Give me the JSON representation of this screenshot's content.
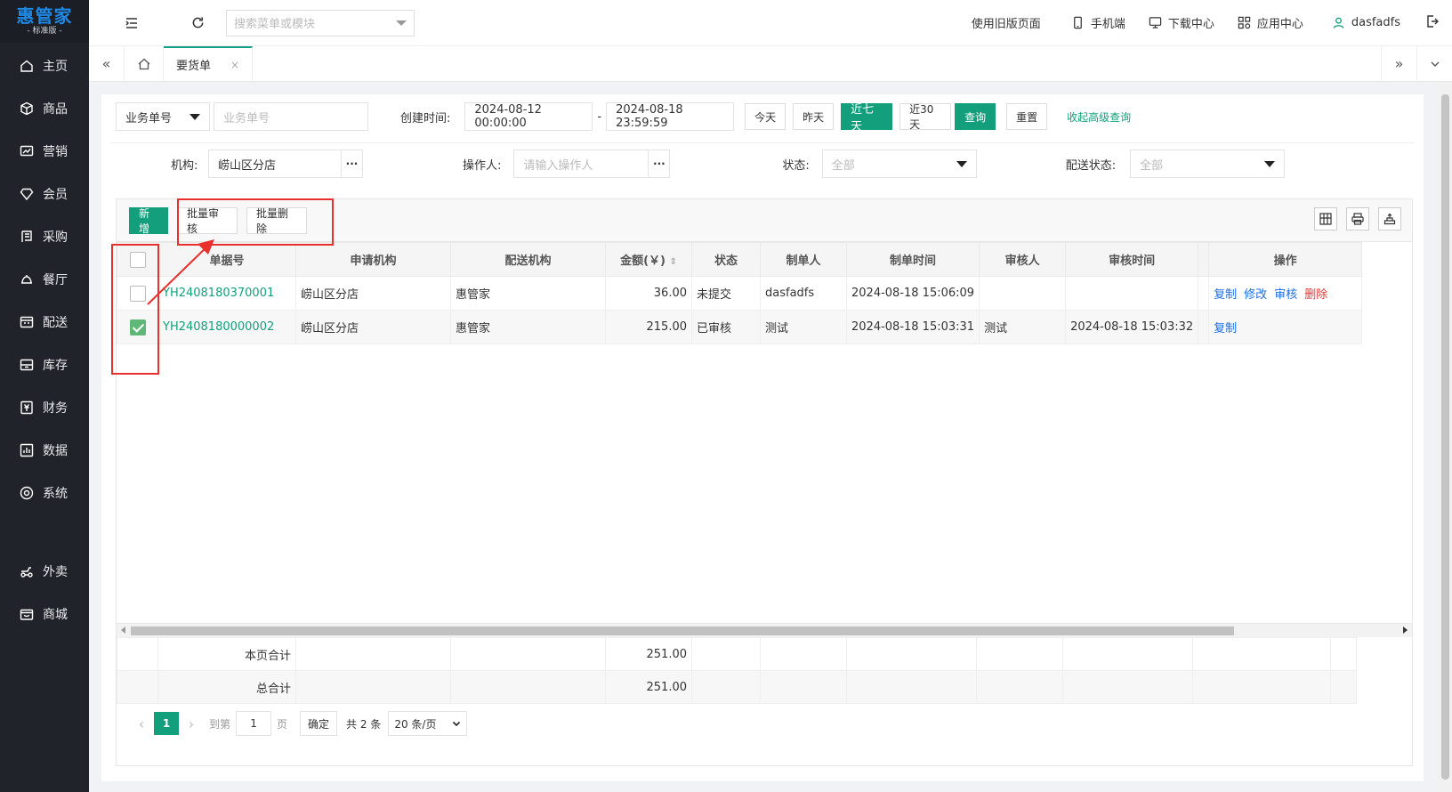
{
  "sidebar": {
    "brand": "惠管家",
    "edition": "- 标准版 -",
    "items": [
      {
        "label": "主页",
        "icon": "home-icon"
      },
      {
        "label": "商品",
        "icon": "box-icon"
      },
      {
        "label": "营销",
        "icon": "chart-icon"
      },
      {
        "label": "会员",
        "icon": "diamond-icon"
      },
      {
        "label": "采购",
        "icon": "purchase-icon"
      },
      {
        "label": "餐厅",
        "icon": "dining-icon"
      },
      {
        "label": "配送",
        "icon": "delivery-icon"
      },
      {
        "label": "库存",
        "icon": "inventory-icon"
      },
      {
        "label": "财务",
        "icon": "finance-icon"
      },
      {
        "label": "数据",
        "icon": "data-icon"
      },
      {
        "label": "系统",
        "icon": "settings-icon"
      }
    ],
    "extra_items": [
      {
        "label": "外卖",
        "icon": "takeout-icon"
      },
      {
        "label": "商城",
        "icon": "mall-icon"
      }
    ]
  },
  "topbar": {
    "search_placeholder": "搜索菜单或模块",
    "old_page": "使用旧版页面",
    "mobile": "手机端",
    "download": "下载中心",
    "apps": "应用中心",
    "user": "dasfadfs"
  },
  "tabs": {
    "active": "要货单",
    "close": "×"
  },
  "filters": {
    "field_select": "业务单号",
    "field_placeholder": "业务单号",
    "created_label": "创建时间:",
    "date_start": "2024-08-12 00:00:00",
    "date_sep": "-",
    "date_end": "2024-08-18 23:59:59",
    "btn_today": "今天",
    "btn_yesterday": "昨天",
    "btn_7days": "近七天",
    "btn_30days": "近30天",
    "btn_query": "查询",
    "btn_reset": "重置",
    "advanced": "收起高级查询",
    "org_label": "机构:",
    "org_value": "崂山区分店",
    "operator_label": "操作人:",
    "operator_placeholder": "请输入操作人",
    "status_label": "状态:",
    "status_value": "全部",
    "delivery_status_label": "配送状态:",
    "delivery_status_value": "全部",
    "dots": "···"
  },
  "toolbar": {
    "add": "新增",
    "batch_approve": "批量审核",
    "batch_delete": "批量删除"
  },
  "table": {
    "headers": [
      "单据号",
      "申请机构",
      "配送机构",
      "金额(￥)",
      "状态",
      "制单人",
      "制单时间",
      "审核人",
      "审核时间",
      "操作"
    ],
    "rows": [
      {
        "checked": false,
        "doc": "YH2408180370001",
        "apply_org": "崂山区分店",
        "delivery_org": "惠管家",
        "amount": "36.00",
        "status": "未提交",
        "creator": "dasfadfs",
        "created": "2024-08-18 15:06:09",
        "approver": "",
        "approved": "",
        "ops": [
          "复制",
          "修改",
          "审核",
          "删除"
        ]
      },
      {
        "checked": true,
        "doc": "YH2408180000002",
        "apply_org": "崂山区分店",
        "delivery_org": "惠管家",
        "amount": "215.00",
        "status": "已审核",
        "creator": "测试",
        "created": "2024-08-18 15:03:31",
        "approver": "测试",
        "approved": "2024-08-18 15:03:32",
        "ops": [
          "复制"
        ]
      }
    ],
    "page_total_label": "本页合计",
    "page_total": "251.00",
    "grand_total_label": "总合计",
    "grand_total": "251.00"
  },
  "pager": {
    "current": "1",
    "goto_label": "到第",
    "goto_value": "1",
    "page_label": "页",
    "confirm": "确定",
    "total": "共 2 条",
    "page_size": "20 条/页"
  },
  "colors": {
    "accent": "#139f7b",
    "sidebar": "#20232a",
    "annotation": "#e8302c",
    "link_blue": "#1e6ee6",
    "danger": "#e53935"
  }
}
